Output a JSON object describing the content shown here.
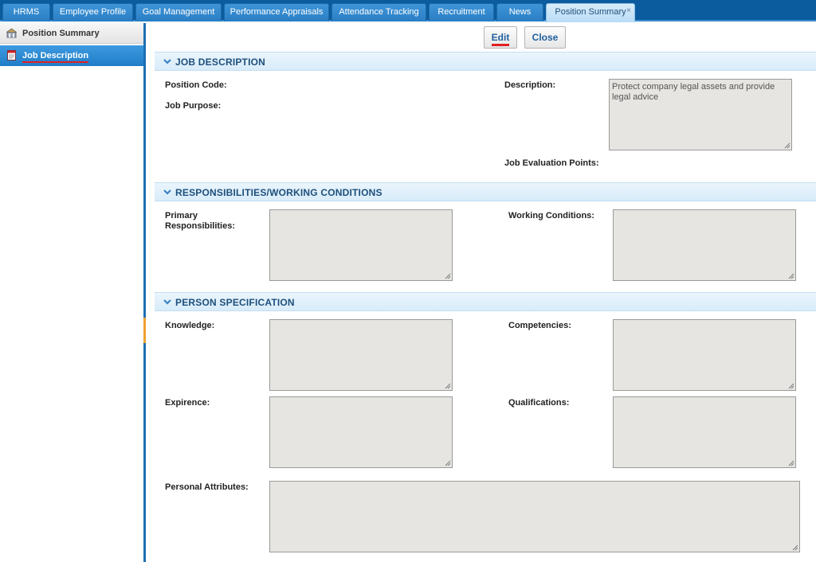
{
  "tabs": [
    {
      "label": "HRMS"
    },
    {
      "label": "Employee Profile"
    },
    {
      "label": "Goal Management"
    },
    {
      "label": "Performance Appraisals"
    },
    {
      "label": "Attendance Tracking"
    },
    {
      "label": "Recruitment"
    },
    {
      "label": "News"
    },
    {
      "label": "Position Summary",
      "close": "×"
    }
  ],
  "sidebar": {
    "items": [
      {
        "label": "Position Summary",
        "icon": "building-icon"
      },
      {
        "label": "Job Description",
        "icon": "document-icon"
      }
    ]
  },
  "toolbar": {
    "edit_label": "Edit",
    "close_label": "Close"
  },
  "sections": {
    "job_description": {
      "title": "JOB DESCRIPTION",
      "position_code_label": "Position Code:",
      "job_purpose_label": "Job Purpose:",
      "description_label": "Description:",
      "description_value": "Protect company legal assets and provide legal advice",
      "job_eval_label": "Job Evaluation Points:"
    },
    "responsibilities": {
      "title": "RESPONSIBILITIES/WORKING CONDITIONS",
      "primary_label": "Primary Responsibilities:",
      "working_label": "Working Conditions:"
    },
    "person_spec": {
      "title": "PERSON SPECIFICATION",
      "knowledge_label": "Knowledge:",
      "competencies_label": "Competencies:",
      "experience_label": "Expirence:",
      "qualifications_label": "Qualifications:",
      "personal_label": "Personal Attributes:"
    }
  },
  "colors": {
    "accent": "#1e6fb3",
    "header_text": "#1d4f7c",
    "underline": "#e02020"
  }
}
